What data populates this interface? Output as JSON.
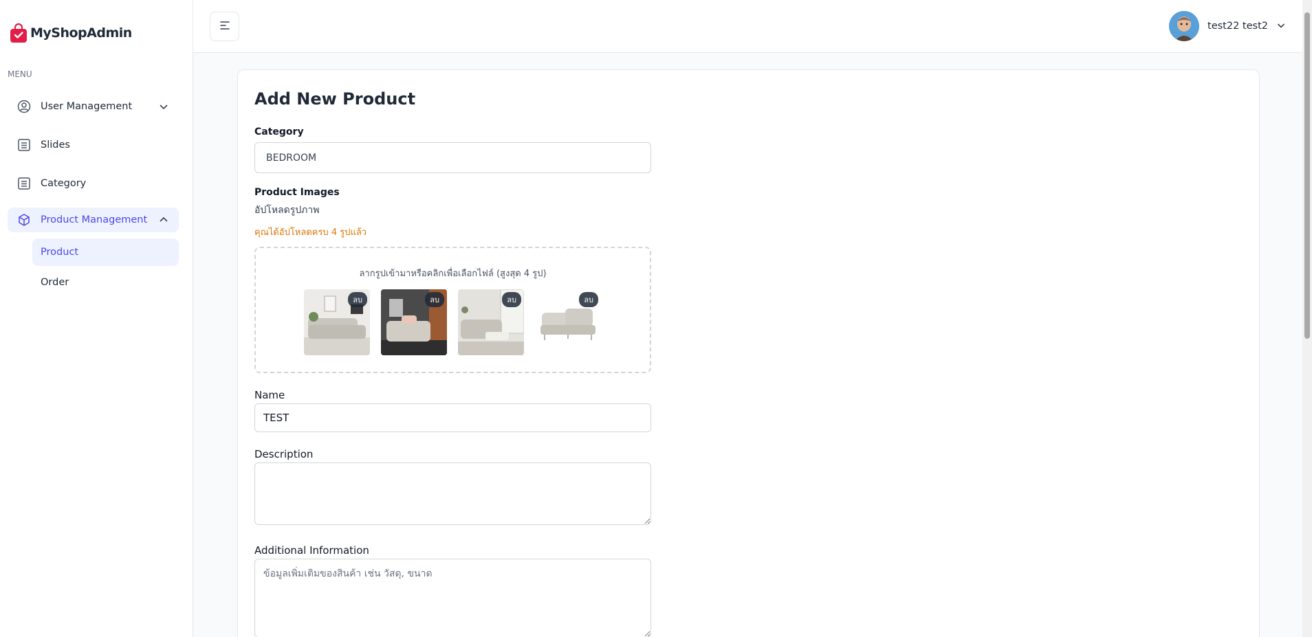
{
  "app": {
    "name": "MyShopAdmin"
  },
  "sidebar": {
    "menu_label": "MENU",
    "items": [
      {
        "label": "User Management",
        "icon": "user-circle-icon",
        "expanded": false
      },
      {
        "label": "Slides",
        "icon": "list-icon"
      },
      {
        "label": "Category",
        "icon": "list-icon"
      },
      {
        "label": "Product Management",
        "icon": "cube-icon",
        "expanded": true,
        "active": true
      }
    ],
    "subitems": [
      {
        "label": "Product",
        "active": true
      },
      {
        "label": "Order",
        "active": false
      }
    ]
  },
  "header": {
    "user_name": "test22 test2"
  },
  "form": {
    "title": "Add New Product",
    "category_label": "Category",
    "category_value": "BEDROOM",
    "images_label": "Product Images",
    "upload_label": "อัปโหลดรูปภาพ",
    "upload_warning": "คุณได้อัปโหลดครบ 4 รูปแล้ว",
    "dropzone_hint": "ลากรูปเข้ามาหรือคลิกเพื่อเลือกไฟล์ (สูงสุด 4 รูป)",
    "delete_label": "ลบ",
    "name_label": "Name",
    "name_value": "TEST",
    "description_label": "Description",
    "description_value": "",
    "additional_label": "Additional Information",
    "additional_placeholder": "ข้อมูลเพิ่มเติมของสินค้า เช่น วัสดุ, ขนาด"
  },
  "colors": {
    "accent": "#4f46e5",
    "accent_bg": "#eef2ff",
    "warning": "#d97706",
    "logo_red": "#e11d48"
  }
}
